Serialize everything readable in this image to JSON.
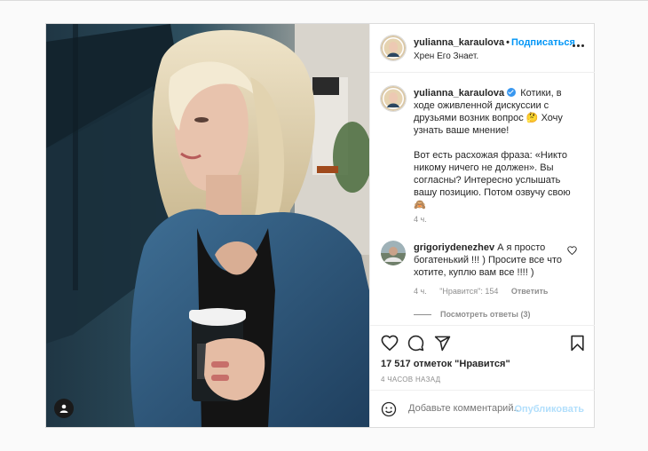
{
  "post": {
    "author": {
      "username": "yulianna_karaulova",
      "follow_label": "Подписаться",
      "location": "Хрен Его Знает."
    },
    "caption": {
      "username": "yulianna_karaulova",
      "paragraph1": "Котики, в ходе оживленной дискуссии с друзьями возник вопрос 🤔 Хочу узнать ваше мнение!",
      "paragraph2": "Вот есть расхожая фраза: «Никто никому ничего не должен». Вы согласны? Интересно услышать вашу позицию. Потом озвучу свою 🙈",
      "time": "4 ч."
    },
    "comment": {
      "username": "grigoriydenezhev",
      "text": "А я просто богатенький !!! ) Просите все что хотите, куплю вам все !!!! )",
      "time": "4 ч.",
      "likes": "\"Нравится\": 154",
      "reply_label": "Ответить",
      "view_replies": "Посмотреть ответы (3)"
    },
    "likes_text": "17 517 отметок \"Нравится\"",
    "date_text": "4 ЧАСОВ НАЗАД",
    "add_comment": {
      "placeholder": "Добавьте комментарий...",
      "publish_label": "Опубликовать"
    }
  },
  "icons": {
    "more": "more-options-icon",
    "verified": "verified-badge-icon",
    "heart_small": "heart-icon",
    "like": "heart-icon",
    "comment": "comment-icon",
    "share": "share-icon",
    "save": "bookmark-icon",
    "emoji": "emoji-icon",
    "tag": "user-tag-icon"
  },
  "colors": {
    "accent": "#0095f6",
    "publish_disabled": "#b2dffc",
    "muted": "#8e8e8e",
    "text": "#262626"
  }
}
